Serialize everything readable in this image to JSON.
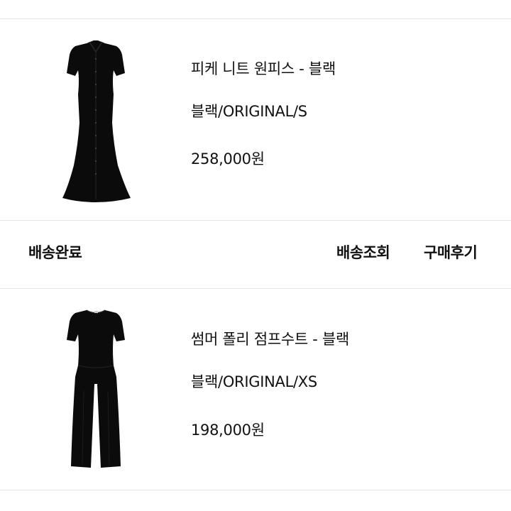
{
  "orders": [
    {
      "product_name": "피케 니트 원피스 - 블랙",
      "option": "블랙/ORIGINAL/S",
      "price": "258,000원",
      "image_icon": "knit-dress-image"
    },
    {
      "product_name": "썸머 폴리 점프수트 - 블랙",
      "option": "블랙/ORIGINAL/XS",
      "price": "198,000원",
      "image_icon": "jumpsuit-image"
    }
  ],
  "status_row": {
    "status": "배송완료",
    "track_label": "배송조회",
    "review_label": "구매후기"
  },
  "colors": {
    "text": "#111111",
    "divider": "#e4e4e4",
    "garment": "#0b0b0b"
  }
}
